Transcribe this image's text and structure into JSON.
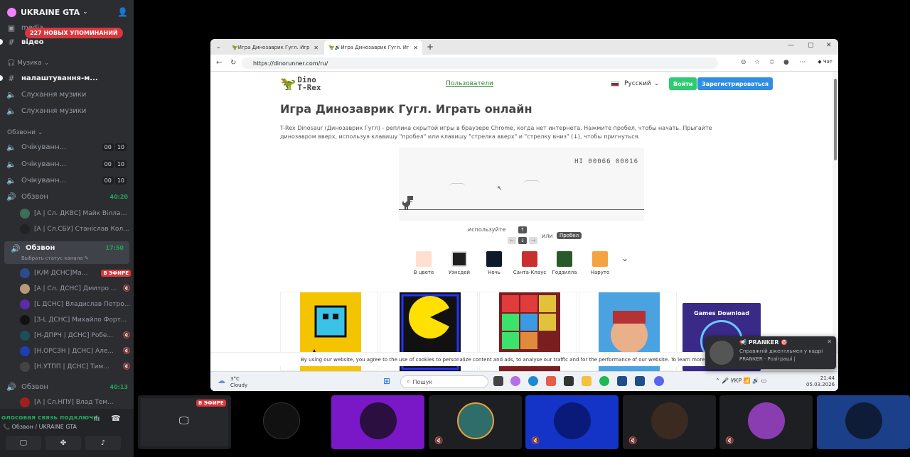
{
  "server": {
    "name": "UKRAINE GTA"
  },
  "mentions": "227 НОВЫХ УПОМИНАНИЙ",
  "channels": {
    "media": "media",
    "video": "відео",
    "cat_music": "Музика",
    "music_text": "налаштування-м...",
    "music_voice_1": "Слухання музики",
    "music_voice_2": "Слухання музики",
    "cat_calls": "Обзвони",
    "wait_1": "Очікуванн...",
    "wait_2": "Очікуванн...",
    "wait_3": "Очікуванн...",
    "wait_pill_a": "00",
    "wait_pill_b": "10",
    "call_1": "Обзвон",
    "call_1_time": "40:20",
    "call_2": "Обзвон",
    "call_2_time": "17:50",
    "call_2_status": "Выбрать статус канала",
    "call_3": "Обзвон",
    "call_3_time": "40:13"
  },
  "users_call1": [
    "[А | Сл. ДКВС] Майк Віллан...",
    "[А | Сл.СБУ] Станіслав Кол..."
  ],
  "users_call2": [
    "[К/М ДСНС]Ма...",
    "[А | Сл. ДСНС] Дмитро ...",
    "[L ДСНС] Владислав Петро...",
    "[З-L ДСНС] Михайло Форт...",
    "[Н-ДПРЧ | ДСНС] Робе...",
    "[Н.ОРСЗН | ДСНС] Але...",
    "[Н.УТПП | ДСНС] Тим..."
  ],
  "users_call3": [
    "[А | Сл.НПУ] Влад Тем..."
  ],
  "live_badge": "В ЭФИРЕ",
  "voice": {
    "status": "олосовая связь подключе",
    "sub": "Обзвон / UKRAINE GTA"
  },
  "browser": {
    "tab1": "Игра Динозаврик Гугл. Играть он",
    "tab2": "Игра Динозаврик Гугл. Играт",
    "url": "https://dinorunner.com/ru/",
    "chat": "Чат"
  },
  "site": {
    "logo_line1": "Dino",
    "logo_line2": "T-Rex",
    "users_link": "Пользователи",
    "lang": "Русский",
    "login": "Войти",
    "register": "Зарегистрироваться",
    "title": "Игра Динозаврик Гугл. Играть онлайн",
    "description": "T-Rex Dinosaur (Динозаврик Гугл) - реплика скрытой игры в браузере Chrome, когда нет интернета. Нажмите пробел, чтобы начать. Прыгайте динозавром вверх, используя клавишу \"пробел\" или клавишу \"стрелка вверх\" и \"стрелку вниз\" (↓), чтобы пригнуться.",
    "score": "HI 00066  00016",
    "controls_use": "используйте",
    "controls_or": "или",
    "controls_space": "Пробел",
    "skins": [
      "В цвете",
      "Уэнсдей",
      "Ночь",
      "Санта-Клаус",
      "Годзилла",
      "Наруто"
    ],
    "ad_text": "Games Download",
    "cookie": "By using our website, you agree to the use of cookies to personalize content and ads, to analyse our traffic and for the performance of our website. To learn more, visit our",
    "cookie_link": "Co"
  },
  "taskbar": {
    "temp": "3°C",
    "weather": "Cloudy",
    "search": "Пошук",
    "lang": "УКР",
    "time": "21:44",
    "date": "05.03.2026"
  },
  "toast": {
    "title": "📢 PRANKER 🎯",
    "line": "Справжній джентльмен у кадрі",
    "sub": "PRANKER · Розіграші |"
  },
  "colors": {
    "discord_bg": "#2b2d31",
    "green": "#23a55a",
    "red": "#da373c",
    "login": "#2ecc71",
    "register": "#2f8de4"
  }
}
